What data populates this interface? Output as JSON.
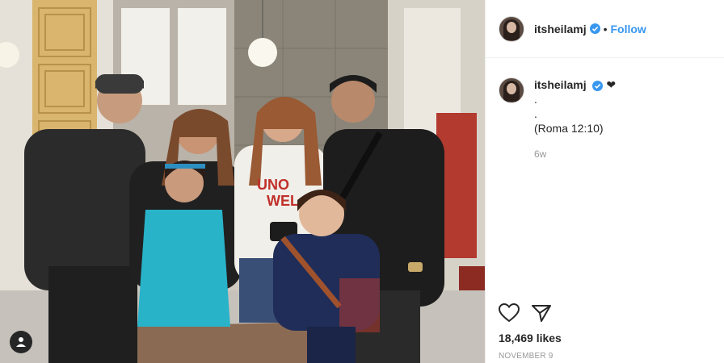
{
  "post": {
    "username": "itsheilamj",
    "follow_label": "Follow",
    "separator": "•",
    "caption_lines": [
      ".",
      ".",
      "(Roma 12:10)"
    ],
    "caption_emoji": "❤",
    "time_ago": "6w",
    "likes": "18,469 likes",
    "date": "NOVEMBER 9"
  },
  "icons": {
    "verified": "verified-badge-icon",
    "heart": "heart-icon",
    "share": "share-icon",
    "user_tag": "user-tag-icon"
  },
  "colors": {
    "link": "#3897f0",
    "verified": "#3897f0",
    "text": "#262626",
    "muted": "#999999",
    "border": "#efefef"
  }
}
